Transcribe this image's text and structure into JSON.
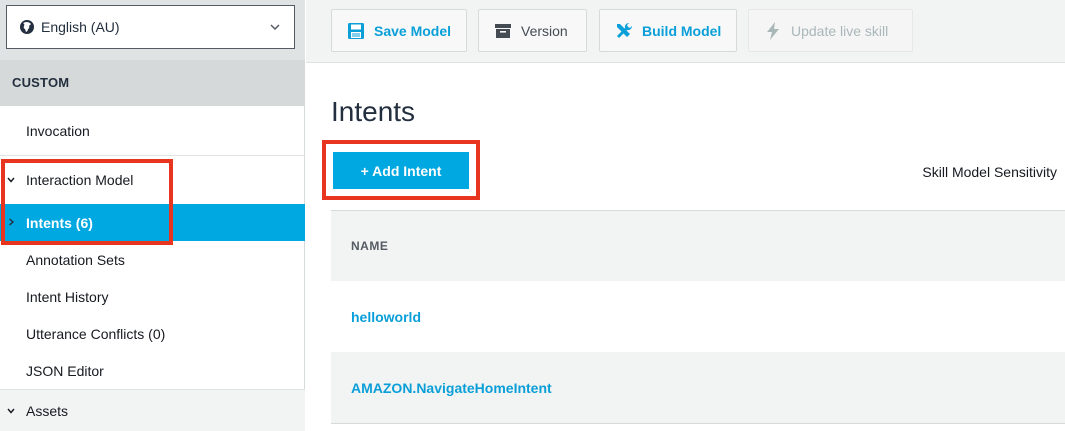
{
  "sidebar": {
    "language": "English (AU)",
    "section": "CUSTOM",
    "items": {
      "invocation": "Invocation",
      "interaction_model": "Interaction Model",
      "intents": "Intents (6)",
      "annotation_sets": "Annotation Sets",
      "intent_history": "Intent History",
      "utterance_conflicts": "Utterance Conflicts (0)",
      "json_editor": "JSON Editor",
      "assets": "Assets"
    }
  },
  "toolbar": {
    "save": "Save Model",
    "version": "Version",
    "build": "Build Model",
    "update": "Update live skill"
  },
  "main": {
    "title": "Intents",
    "add_button": "+ Add Intent",
    "sensitivity": "Skill Model Sensitivity",
    "table": {
      "header": "NAME",
      "rows": [
        "helloworld",
        "AMAZON.NavigateHomeIntent"
      ]
    }
  },
  "colors": {
    "accent": "#00a8e1",
    "highlight": "#e8351f"
  }
}
